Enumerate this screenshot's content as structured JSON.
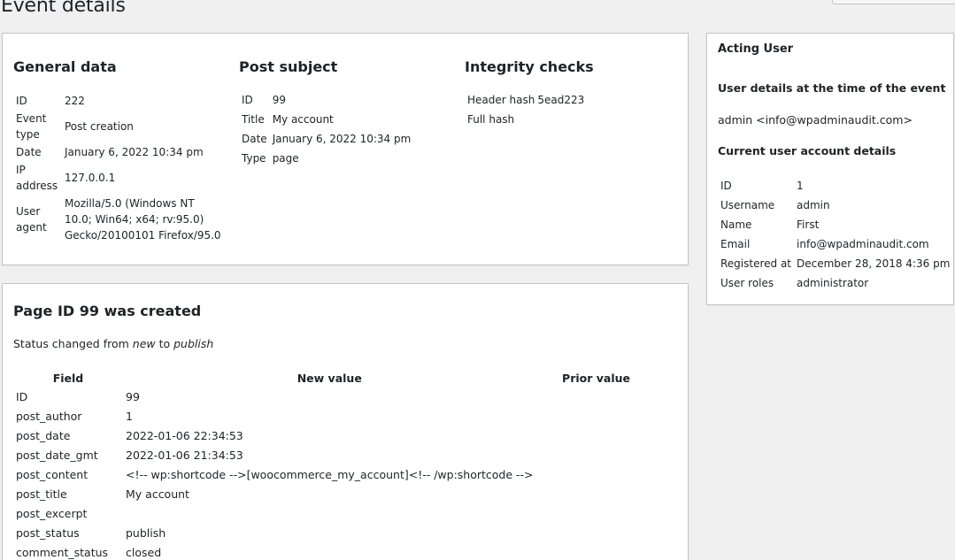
{
  "page": {
    "title": "Event details"
  },
  "general": {
    "heading": "General data",
    "rows": [
      {
        "key": "ID",
        "value": "222"
      },
      {
        "key": "Event type",
        "value": "Post creation"
      },
      {
        "key": "Date",
        "value": "January 6, 2022 10:34 pm"
      },
      {
        "key": "IP address",
        "value": "127.0.0.1"
      },
      {
        "key": "User agent",
        "value": "Mozilla/5.0 (Windows NT 10.0; Win64; x64; rv:95.0) Gecko/20100101 Firefox/95.0"
      }
    ]
  },
  "post_subject": {
    "heading": "Post subject",
    "rows": [
      {
        "key": "ID",
        "value": "99"
      },
      {
        "key": "Title",
        "value": "My account"
      },
      {
        "key": "Date",
        "value": "January 6, 2022 10:34 pm"
      },
      {
        "key": "Type",
        "value": "page"
      }
    ]
  },
  "integrity": {
    "heading": "Integrity checks",
    "rows": [
      {
        "key": "Header hash",
        "value": "5ead223"
      },
      {
        "key": "Full hash",
        "value": ""
      }
    ]
  },
  "acting_user": {
    "heading": "Acting User",
    "time_of_event_heading": "User details at the time of the event",
    "time_of_event_value": "admin <info@wpadminaudit.com>",
    "current_heading": "Current user account details",
    "rows": [
      {
        "key": "ID",
        "value": "1"
      },
      {
        "key": "Username",
        "value": "admin"
      },
      {
        "key": "Name",
        "value": "First"
      },
      {
        "key": "Email",
        "value": "info@wpadminaudit.com"
      },
      {
        "key": "Registered at",
        "value": "December 28, 2018 4:36 pm"
      },
      {
        "key": "User roles",
        "value": "administrator"
      }
    ]
  },
  "changes": {
    "title": "Page ID 99 was created",
    "status_prefix": "Status changed from ",
    "status_from": "new",
    "status_mid": " to ",
    "status_to": "publish",
    "columns": [
      "Field",
      "New value",
      "Prior value"
    ],
    "rows": [
      {
        "field": "ID",
        "new": "99",
        "prior": ""
      },
      {
        "field": "post_author",
        "new": "1",
        "prior": ""
      },
      {
        "field": "post_date",
        "new": "2022-01-06 22:34:53",
        "prior": ""
      },
      {
        "field": "post_date_gmt",
        "new": "2022-01-06 21:34:53",
        "prior": ""
      },
      {
        "field": "post_content",
        "new": "<!-- wp:shortcode -->[woocommerce_my_account]<!-- /wp:shortcode -->",
        "prior": ""
      },
      {
        "field": "post_title",
        "new": "My account",
        "prior": ""
      },
      {
        "field": "post_excerpt",
        "new": "",
        "prior": ""
      },
      {
        "field": "post_status",
        "new": "publish",
        "prior": ""
      },
      {
        "field": "comment_status",
        "new": "closed",
        "prior": ""
      }
    ]
  }
}
